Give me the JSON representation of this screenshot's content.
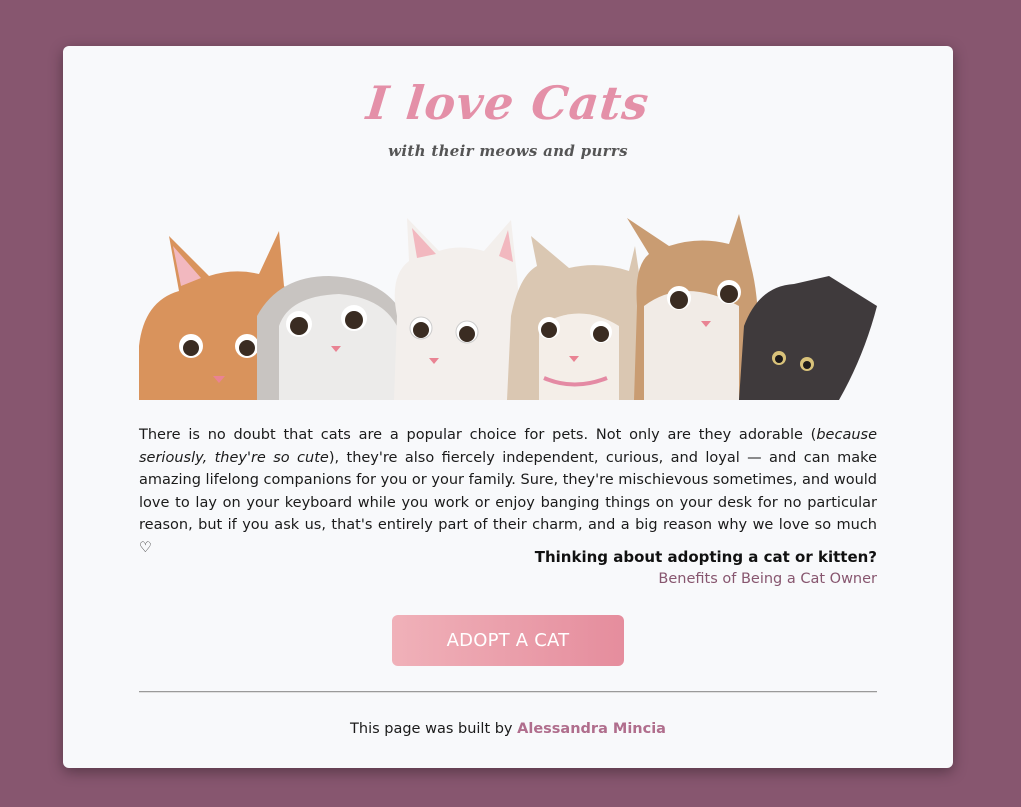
{
  "header": {
    "title": "I love Cats",
    "subtitle": "with their meows and purrs"
  },
  "hero": {
    "icon": "cats-illustration",
    "colors": [
      "#d98d55",
      "#b9b6b3",
      "#f3efec",
      "#d8c6b0",
      "#c89a70",
      "#3f3a3c"
    ]
  },
  "bio": {
    "part1": "There is no doubt that cats are a popular choice for pets. Not only are they adorable (",
    "emphasis": "because seriously, they're so cute",
    "part2": "), they're also fiercely independent, curious, and loyal — and can make amazing lifelong companions for you or your family. Sure, they're mischievous sometimes, and would love to lay on your keyboard while you work or enjoy banging things on your desk for no particular reason, but if you ask us, that's entirely part of their charm, and a big reason why we love so much ♡"
  },
  "cta": {
    "question": "Thinking about adopting a cat or kitten?",
    "link": "Benefits of Being a Cat Owner",
    "button": "ADOPT A CAT"
  },
  "footer": {
    "prefix": "This page was built by ",
    "author": "Alessandra Mincia"
  },
  "theme": {
    "background": "#87566f",
    "card": "#f8f9fb",
    "accent": "#e490a8",
    "link": "#87566f"
  }
}
